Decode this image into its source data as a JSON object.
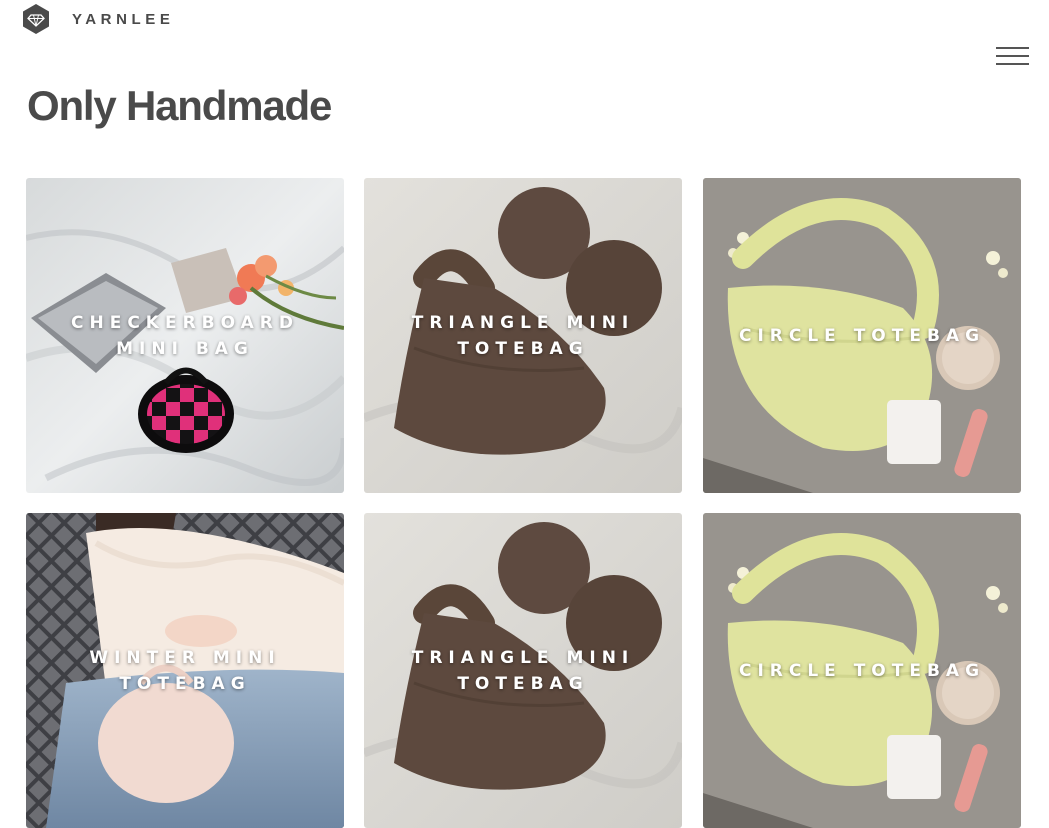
{
  "header": {
    "brand": "YARNLEE",
    "logo_icon": "gem-hexagon-icon",
    "menu_icon": "hamburger-menu-icon"
  },
  "main": {
    "title": "Only Handmade"
  },
  "products": [
    {
      "name": "CHECKERBOARD MINI BAG",
      "image": "checkerboard-bag-photo"
    },
    {
      "name": "TRIANGLE MINI TOTEBAG",
      "image": "brown-triangle-bag-photo"
    },
    {
      "name": "CIRCLE TOTEBAG",
      "image": "yellow-circle-bag-photo"
    },
    {
      "name": "WINTER MINI TOTEBAG",
      "image": "pink-winter-bag-photo"
    },
    {
      "name": "TRIANGLE MINI TOTEBAG",
      "image": "brown-triangle-bag-photo"
    },
    {
      "name": "CIRCLE TOTEBAG",
      "image": "yellow-circle-bag-photo"
    }
  ],
  "colors": {
    "text": "#4a4a4a",
    "caption": "#ffffff"
  }
}
